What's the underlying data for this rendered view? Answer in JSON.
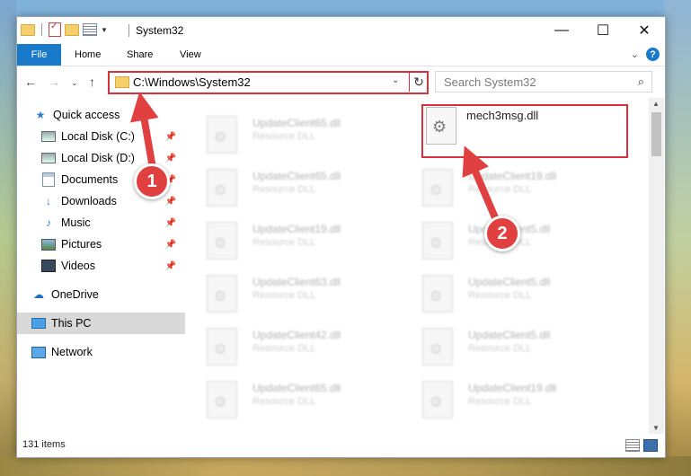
{
  "window": {
    "title": "System32"
  },
  "ribbon": {
    "tabs": [
      "File",
      "Home",
      "Share",
      "View"
    ]
  },
  "address": {
    "path": "C:\\Windows\\System32"
  },
  "search": {
    "placeholder": "Search System32"
  },
  "sidebar": {
    "items": [
      {
        "label": "Quick access",
        "icon": "star-icon",
        "pinned": false
      },
      {
        "label": "Local Disk (C:)",
        "icon": "local-disk-icon",
        "pinned": true
      },
      {
        "label": "Local Disk (D:)",
        "icon": "local-disk-icon",
        "pinned": true
      },
      {
        "label": "Documents",
        "icon": "documents-icon",
        "pinned": true
      },
      {
        "label": "Downloads",
        "icon": "downloads-icon",
        "pinned": true
      },
      {
        "label": "Music",
        "icon": "music-icon",
        "pinned": true
      },
      {
        "label": "Pictures",
        "icon": "pictures-icon",
        "pinned": true
      },
      {
        "label": "Videos",
        "icon": "videos-icon",
        "pinned": true
      },
      {
        "label": "OneDrive",
        "icon": "onedrive-icon",
        "pinned": false
      },
      {
        "label": "This PC",
        "icon": "this-pc-icon",
        "pinned": false,
        "selected": true
      },
      {
        "label": "Network",
        "icon": "network-icon",
        "pinned": false
      }
    ]
  },
  "files": {
    "left": [
      {
        "name": "UpdateClient65.dll",
        "type": "Resource DLL"
      },
      {
        "name": "UpdateClient65.dll",
        "type": "Resource DLL"
      },
      {
        "name": "UpdateClient19.dll",
        "type": "Resource DLL"
      },
      {
        "name": "UpdateClient63.dll",
        "type": "Resource DLL"
      },
      {
        "name": "UpdateClient42.dll",
        "type": "Resource DLL"
      },
      {
        "name": "UpdateClient65.dll",
        "type": "Resource DLL"
      }
    ],
    "right": [
      {
        "name": "UpdateClient19.dll",
        "type": "Resource DLL"
      },
      {
        "name": "UpdateClient5.dll",
        "type": "Resource DLL"
      },
      {
        "name": "UpdateClient5.dll",
        "type": "Resource DLL"
      },
      {
        "name": "UpdateClient5.dll",
        "type": "Resource DLL"
      },
      {
        "name": "UpdateClient19.dll",
        "type": "Resource DLL"
      }
    ],
    "highlighted": {
      "name": "mech3msg.dll"
    }
  },
  "status": {
    "item_count": "131 items"
  },
  "annotations": {
    "step1": "1",
    "step2": "2",
    "color": "#e04040"
  }
}
